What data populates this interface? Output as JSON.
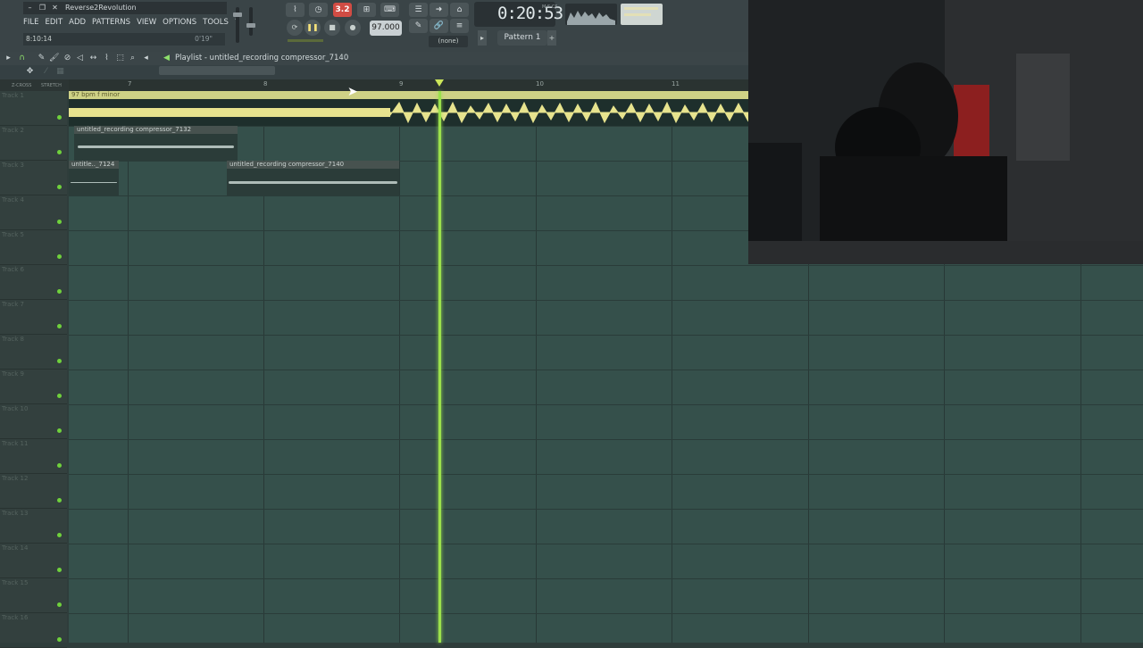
{
  "app": {
    "title": "Reverse2Revolution",
    "menu": [
      "FILE",
      "EDIT",
      "ADD",
      "PATTERNS",
      "VIEW",
      "OPTIONS",
      "TOOLS",
      "?"
    ],
    "hint_left": "8:10:14",
    "hint_right": "0'19\""
  },
  "toolbar": {
    "snap_label": "3.2",
    "tempo": "97.000",
    "time": "0:20:53",
    "time_unit": "M:S:CS",
    "pattern": "Pattern 1",
    "arrangement": "(none)"
  },
  "playlist": {
    "title": "Playlist - untitled_recording compressor_7140",
    "ruler": [
      "7",
      "8",
      "9",
      "10",
      "11"
    ],
    "tracks": [
      "Track 1",
      "Track 2",
      "Track 3",
      "Track 4",
      "Track 5",
      "Track 6",
      "Track 7",
      "Track 8",
      "Track 9",
      "Track 10",
      "Track 11",
      "Track 12",
      "Track 13",
      "Track 14",
      "Track 15",
      "Track 16"
    ],
    "clips": {
      "main": "97 bpm f minor",
      "t2": "untitled_recording compressor_7132",
      "t3a": "untitle.._7124",
      "t3b": "untitled_recording compressor_7140"
    },
    "sub_labels": [
      "Z-CROSS",
      "STRETCH"
    ]
  },
  "colors": {
    "accent_red": "#d14c44",
    "playhead": "#9be14c",
    "main_clip": "#cfd286",
    "grid_bg": "#35504b"
  }
}
